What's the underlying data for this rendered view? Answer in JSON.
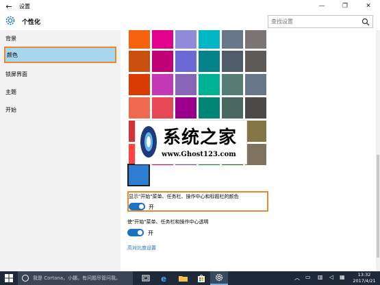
{
  "window": {
    "title": "设置",
    "back_glyph": "←",
    "minimize_glyph": "—",
    "maximize_glyph": "❐",
    "close_glyph": "✕"
  },
  "header": {
    "title": "个性化",
    "search_placeholder": "查找设置"
  },
  "sidebar": {
    "items": [
      {
        "label": "背景",
        "active": false
      },
      {
        "label": "颜色",
        "active": true
      },
      {
        "label": "锁屏界面",
        "active": false
      },
      {
        "label": "主题",
        "active": false
      },
      {
        "label": "开始",
        "active": false
      }
    ]
  },
  "color_grid": {
    "rows": [
      [
        "#f7630c",
        "#e3008c",
        "#8e8cd8",
        "#00b7c3",
        "#68768a",
        "#7a7574"
      ],
      [
        "#ca5010",
        "#bf0077",
        "#6b69d6",
        "#038387",
        "#515c6b",
        "#5d5a58"
      ],
      [
        "#da3b01",
        "#c239b3",
        "#8764b8",
        "#00b294",
        "#567c73",
        "#68768a"
      ],
      [
        "#ef6950",
        "#e74856",
        "#9a0089",
        "#018574",
        "#486860",
        "#4c4a48"
      ],
      [
        "#d13438",
        "#e81123",
        "#881798",
        "#00cc6a",
        "#498205",
        "#847545"
      ],
      [
        "#ff4343",
        "#ea005e",
        "#744da9",
        "#10893e",
        "#107c10",
        "#7e735f"
      ]
    ],
    "selected_color": "#2d7dd2"
  },
  "watermark": {
    "big_text": "系统之家",
    "small_text": "www.Ghost123.com"
  },
  "options": {
    "show_color_label": "显示\"开始\"菜单、任务栏、操作中心和标题栏的颜色",
    "show_color_state": "开",
    "transparent_label": "使\"开始\"菜单、任务栏和操作中心透明",
    "transparent_state": "开",
    "high_contrast_link": "高对比度设置"
  },
  "taskbar": {
    "search_text": "我是 Cortana，小娜。有问题尽管问我。",
    "time": "13:32",
    "date": "2017/4/21"
  },
  "colors": {
    "accent": "#1a72c4",
    "highlight_border": "#e8882f",
    "sidebar_active_bg": "#a6d6f0",
    "taskbar_bg": "#1e2a3a"
  }
}
